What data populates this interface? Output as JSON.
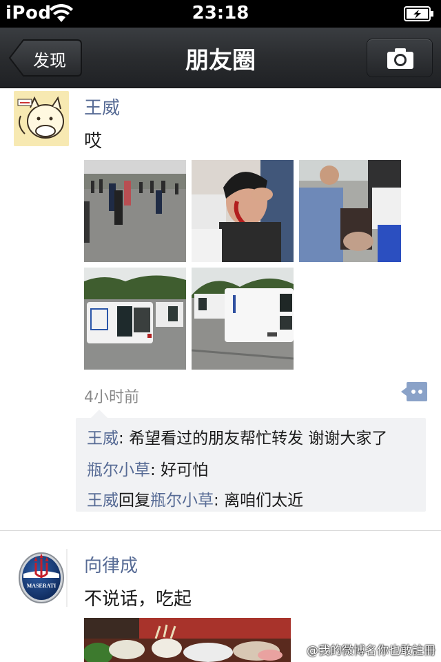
{
  "status_bar": {
    "carrier": "iPod",
    "time": "23:18"
  },
  "nav": {
    "back_label": "发现",
    "title": "朋友圈"
  },
  "post1": {
    "author": "王威",
    "text": "哎",
    "time": "4小时前",
    "photos": [
      "riot-crowd-photo",
      "injured-man-photo",
      "crowd-helping-photo",
      "overturned-police-car-photo",
      "overturned-van-photo"
    ],
    "comments": [
      {
        "name": "王威",
        "sep": ": ",
        "text": "希望看过的朋友帮忙转发 谢谢大家了"
      },
      {
        "name": "瓶尔小草",
        "sep": ": ",
        "text": "好可怕"
      },
      {
        "name": "王威",
        "reply_word": "回复",
        "reply_to": "瓶尔小草",
        "sep": ": ",
        "text": "离咱们太近"
      }
    ]
  },
  "post2": {
    "author": "向律成",
    "text": "不说话，吃起",
    "avatar_brand": "MASERATI"
  },
  "watermark": "@我的微博名你也敢註冊",
  "colors": {
    "name_link": "#576b95",
    "navbar": "#2a2c2f",
    "comment_bg": "#f1f2f4"
  }
}
